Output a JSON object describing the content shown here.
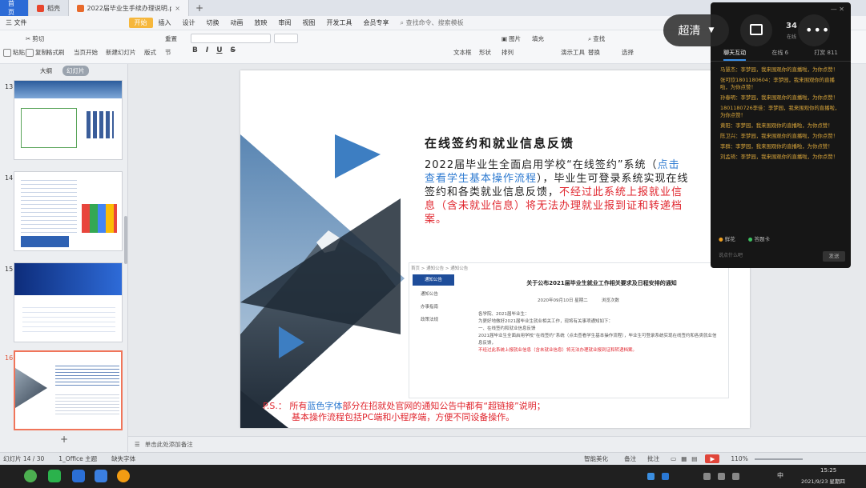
{
  "tabs": {
    "home": "首页",
    "docer": "稻壳",
    "file": "2022届毕业生手续办理说明.ppt",
    "plus": "+"
  },
  "menu": {
    "file": "三 文件",
    "items": [
      "开始",
      "插入",
      "设计",
      "切换",
      "动画",
      "放映",
      "审阅",
      "视图",
      "开发工具",
      "会员专享"
    ],
    "search": "查找命令、搜索模板"
  },
  "ribbon": {
    "paste": "粘贴",
    "cut": "剪切",
    "copy": "复制",
    "format_painter": "格式刷",
    "from_current": "当页开始",
    "new_slide": "新建幻灯片",
    "layout": "版式",
    "section": "节",
    "reset": "重置",
    "textbox": "文本框",
    "shape": "形状",
    "arrange": "排列",
    "picture": "图片",
    "fill": "填充",
    "find": "查找",
    "replace": "替换",
    "presenter": "演示工具",
    "select": "选择",
    "bold": "B",
    "italic": "I",
    "underline": "U",
    "strike": "S"
  },
  "panel": {
    "outline": "大纲",
    "slides": "幻灯片",
    "add": "+",
    "thumbs": [
      {
        "num": "13"
      },
      {
        "num": "14"
      },
      {
        "num": "15"
      },
      {
        "num": "16"
      }
    ]
  },
  "slide": {
    "title": "在线签约和就业信息反馈",
    "body_prefix": "2022届毕业生全面启用学校“在线签约”系统（",
    "body_link": "点击查看学生基本操作流程",
    "body_mid": "），毕业生可登录系统实现在线签约和各类就业信息反馈，",
    "body_warn": "不经过此系统上报就业信息（含未就业信息）将无法办理就业报到证和转递档案。",
    "notice_title": "关于公布2021届毕业生就业工作相关要求及日程安排的通知",
    "notice_tabs": [
      "通知公告",
      "通知公告",
      "办事指南",
      "政策法规"
    ],
    "notice_breadcrumb": "首页 > 通知公告 > 通知公告",
    "notice_date": "2020年09月10日 星期二",
    "notice_views": "浏览次数",
    "notice_para1": "各学院、2021届毕业生：",
    "notice_para2": "为更好地做好2021届毕业生就业相关工作，现将有关事项通知如下：",
    "notice_para3": "一、在线签约和就业信息反馈",
    "notice_para4": "2021届毕业生全面启用学校“在线签约”系统（点击查看学生基本操作流程），毕业生可登录系统实现在线签约和各类就业信息反馈，",
    "notice_para4_red": "不经过此系统上报就业信息（含未就业信息）将无法办理就业报到证和转递档案。",
    "ps_prefix": "P.S.： 所有",
    "ps_blue": "蓝色字体",
    "ps_rest": "部分在招就处官网的通知公告中都有“超链接”说明；",
    "ps_line2": "基本操作流程包括PC端和小程序端，方便不同设备操作。"
  },
  "notes": {
    "placeholder": "单击此处添加备注"
  },
  "status": {
    "slide_count": "幻灯片 14 / 30",
    "theme": "1_Office 主题",
    "font_missing": "缺失字体",
    "smart_beautify": "智能美化",
    "notes": "备注",
    "comments": "批注",
    "zoom": "110%"
  },
  "chat": {
    "tab_chat": "聊天互动",
    "tab_online": "在线 6",
    "tab_gift": "打赏 811",
    "messages": [
      "马慧杰：李梦园，我来围观你的直播啦，为你点赞！",
      "张可欣1801180604：李梦园，我来围观你的直播啦，为你点赞！",
      "孙春明：李梦园，我来围观你的直播啦，为你点赞！",
      "1801180726李佳：李梦园，我来围观你的直播啦，为你点赞！",
      "黄阳：李梦园，我来围观你的直播啦，为你点赞！",
      "陈卫兴：李梦园，我来围观你的直播啦，为你点赞！",
      "李群：李梦园，我来围观你的直播啦，为你点赞！",
      "刘孟琦：李梦园，我来围观你的直播啦，为你点赞！"
    ],
    "like": "鲜花",
    "card": "答题卡",
    "input_placeholder": "说点什么吧",
    "send": "发送",
    "count_a": "34",
    "label_a": "在线"
  },
  "video": {
    "quality": "超清"
  },
  "taskbar": {
    "time": "15:25",
    "date": "2021/9/23 星期四",
    "ime": "中"
  }
}
